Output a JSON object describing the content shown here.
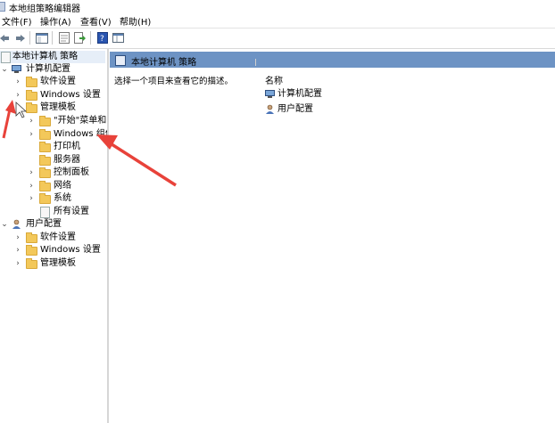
{
  "window": {
    "title": "本地组策略编辑器"
  },
  "menu": [
    "文件(F)",
    "操作(A)",
    "查看(V)",
    "帮助(H)"
  ],
  "toolbar": {
    "buttons": [
      "back-icon",
      "forward-icon",
      "show-tree-icon",
      "properties-icon",
      "export-icon",
      "help-icon",
      "view-icon"
    ]
  },
  "tree": {
    "root": "本地计算机 策略",
    "computer_config": "计算机配置",
    "software_settings": "软件设置",
    "windows_settings": "Windows 设置",
    "admin_templates": "管理模板",
    "start_menu": "\"开始\"菜单和",
    "windows_components": "Windows 组件",
    "printers": "打印机",
    "servers": "服务器",
    "control_panel": "控制面板",
    "network": "网络",
    "system": "系统",
    "all_settings": "所有设置",
    "user_config": "用户配置",
    "user_software_settings": "软件设置",
    "user_windows_settings": "Windows 设置",
    "user_admin_templates": "管理模板"
  },
  "content": {
    "header": "本地计算机 策略",
    "description": "选择一个项目来查看它的描述。",
    "column_name": "名称",
    "items": [
      "计算机配置",
      "用户配置"
    ]
  },
  "colors": {
    "header_bar": "#6d93c4",
    "arrow": "#e8423a",
    "folder": "#f3c85a"
  }
}
